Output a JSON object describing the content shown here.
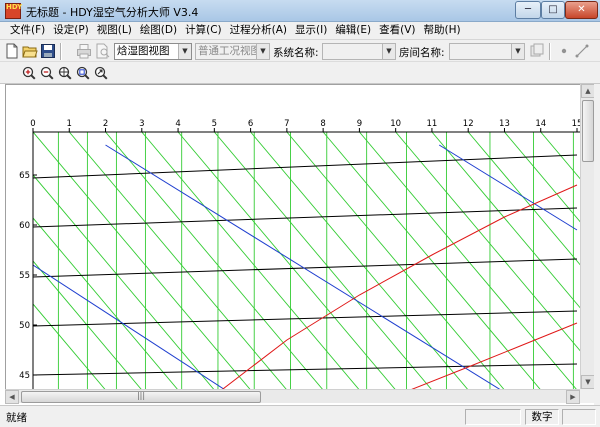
{
  "window": {
    "title": "无标题 - HDY湿空气分析大师 V3.4",
    "icon_text": "HDY"
  },
  "menu": [
    {
      "label": "文件(F)"
    },
    {
      "label": "设定(P)"
    },
    {
      "label": "视图(L)"
    },
    {
      "label": "绘图(D)"
    },
    {
      "label": "计算(C)"
    },
    {
      "label": "过程分析(A)"
    },
    {
      "label": "显示(I)"
    },
    {
      "label": "编辑(E)"
    },
    {
      "label": "查看(V)"
    },
    {
      "label": "帮助(H)"
    }
  ],
  "toolbar": {
    "view_combo": "焓湿图视图",
    "condition_combo": "普通工况视图",
    "system_label": "系统名称:",
    "system_value": "",
    "room_label": "房间名称:",
    "room_value": ""
  },
  "status": {
    "text": "就绪",
    "numlock": "数字"
  },
  "icons": {
    "new": "new-file-icon",
    "open": "open-folder-icon",
    "save": "save-disk-icon",
    "print": "print-icon",
    "preview": "print-preview-icon",
    "zoom_in": "zoom-in-icon",
    "zoom_out": "zoom-out-icon",
    "zoom_fit": "zoom-fit-icon",
    "zoom_window": "zoom-window-icon",
    "zoom_pan": "zoom-pan-icon"
  },
  "chart_data": {
    "type": "line",
    "x_ticks": [
      "0",
      "1",
      "2",
      "3",
      "4",
      "5",
      "6",
      "7",
      "8",
      "9",
      "10",
      "11",
      "12",
      "13",
      "14",
      "15"
    ],
    "y_ticks": [
      "45",
      "50",
      "55",
      "60",
      "65"
    ],
    "xlim": [
      0,
      15
    ],
    "ylim": [
      43.5,
      69.3
    ],
    "colors": {
      "enthalpy": "#000000",
      "humidity_vertical": "#33cc33",
      "temperature_diagonal": "#33cc33",
      "blue_lines": "#1f3fcf",
      "red_curves": "#e01818"
    },
    "enthalpy_lines": [
      {
        "y0": 64.7,
        "y1": 67.0
      },
      {
        "y0": 59.8,
        "y1": 61.7
      },
      {
        "y0": 54.8,
        "y1": 56.6
      },
      {
        "y0": 49.9,
        "y1": 51.4
      },
      {
        "y0": 45.0,
        "y1": 46.1
      }
    ],
    "green_verticals": [
      0.7,
      1.5,
      2.3,
      3.1,
      4.1,
      5.1,
      6.1,
      7.1,
      8.1,
      9.2,
      10.3,
      11.4,
      12.6,
      13.8,
      14.9
    ],
    "green_diagonals": [
      {
        "x0": -4.0,
        "y0": 69.3,
        "x1": 2.0,
        "y1": 43.5
      },
      {
        "x0": -3.0,
        "y0": 69.3,
        "x1": 3.0,
        "y1": 43.5
      },
      {
        "x0": -2.0,
        "y0": 69.3,
        "x1": 4.0,
        "y1": 43.5
      },
      {
        "x0": -1.0,
        "y0": 69.3,
        "x1": 5.0,
        "y1": 43.5
      },
      {
        "x0": 0.0,
        "y0": 69.3,
        "x1": 6.0,
        "y1": 43.5
      },
      {
        "x0": 1.0,
        "y0": 69.3,
        "x1": 7.0,
        "y1": 43.5
      },
      {
        "x0": 2.0,
        "y0": 69.3,
        "x1": 8.0,
        "y1": 43.5
      },
      {
        "x0": 3.0,
        "y0": 69.3,
        "x1": 9.0,
        "y1": 43.5
      },
      {
        "x0": 4.0,
        "y0": 69.3,
        "x1": 10.0,
        "y1": 43.5
      },
      {
        "x0": 5.0,
        "y0": 69.3,
        "x1": 11.0,
        "y1": 43.5
      },
      {
        "x0": 6.0,
        "y0": 69.3,
        "x1": 12.0,
        "y1": 43.5
      },
      {
        "x0": 7.0,
        "y0": 69.3,
        "x1": 13.0,
        "y1": 43.5
      },
      {
        "x0": 8.0,
        "y0": 69.3,
        "x1": 14.0,
        "y1": 43.5
      },
      {
        "x0": 9.0,
        "y0": 69.3,
        "x1": 15.0,
        "y1": 43.5
      },
      {
        "x0": 10.0,
        "y0": 69.3,
        "x1": 16.0,
        "y1": 43.5
      },
      {
        "x0": 11.0,
        "y0": 69.3,
        "x1": 17.0,
        "y1": 43.5
      },
      {
        "x0": 12.0,
        "y0": 69.3,
        "x1": 18.0,
        "y1": 43.5
      },
      {
        "x0": 13.0,
        "y0": 69.3,
        "x1": 19.0,
        "y1": 43.5
      },
      {
        "x0": 14.0,
        "y0": 69.3,
        "x1": 20.0,
        "y1": 43.5
      }
    ],
    "blue_lines": [
      {
        "x0": 2.0,
        "y0": 68.0,
        "x1": 12.9,
        "y1": 43.5
      },
      {
        "x0": 0.0,
        "y0": 56.0,
        "x1": 5.3,
        "y1": 43.5
      },
      {
        "x0": 11.2,
        "y0": 68.0,
        "x1": 15.0,
        "y1": 59.5
      }
    ],
    "red_curves": [
      [
        [
          5.2,
          43.5
        ],
        [
          7.0,
          48.5
        ],
        [
          9.0,
          53.0
        ],
        [
          11.0,
          57.0
        ],
        [
          13.0,
          60.8
        ],
        [
          15.0,
          64.0
        ]
      ],
      [
        [
          10.4,
          43.5
        ],
        [
          12.0,
          45.8
        ],
        [
          13.5,
          48.0
        ],
        [
          15.0,
          50.2
        ]
      ]
    ]
  }
}
